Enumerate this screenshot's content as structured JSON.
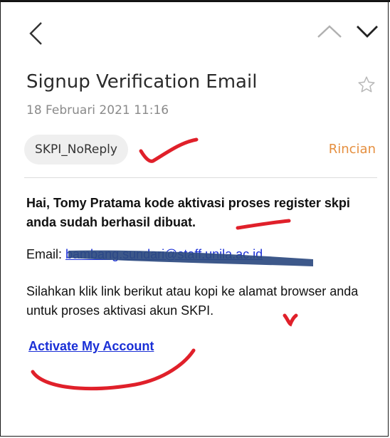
{
  "header": {
    "back_icon": "chevron-left-icon",
    "prev_icon": "chevron-up-icon",
    "next_icon": "chevron-down-icon"
  },
  "message": {
    "subject": "Signup Verification Email",
    "date": "18 Februari 2021 11:16",
    "sender": "SKPI_NoReply",
    "details_label": "Rincian",
    "star_icon": "star-outline-icon"
  },
  "body": {
    "greeting": "Hai, Tomy Pratama kode aktivasi proses register skpi anda sudah berhasil dibuat.",
    "email_label": "Email:",
    "email_value": "bambang.sundari@staff.unila.ac.id",
    "instructions": "Silahkan klik link berikut atau kopi ke alamat browser anda untuk proses aktivasi akun SKPI.",
    "activate_label": "Activate My Account"
  },
  "colors": {
    "accent": "#e58f3f",
    "link": "#1a2fd6",
    "annotation": "#e0202a",
    "redaction": "#2c4a80"
  }
}
